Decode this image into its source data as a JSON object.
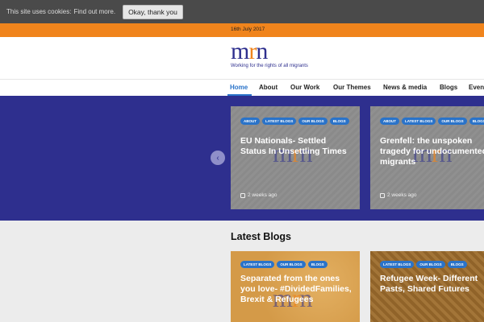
{
  "cookie_bar": {
    "text": "This site uses cookies:",
    "link": "Find out more.",
    "button": "Okay, thank you"
  },
  "date": "16th July 2017",
  "logo": {
    "mark_m": "m",
    "mark_r": "r",
    "mark_n": "n",
    "tagline": "Working for the rights of all migrants"
  },
  "nav": [
    "Home",
    "About",
    "Our Work",
    "Our Themes",
    "News & media",
    "Blogs",
    "Events"
  ],
  "hero_cards": [
    {
      "tags": [
        "About",
        "Latest Blogs",
        "Our Blogs",
        "Blogs"
      ],
      "title": "EU Nationals- Settled Status In Unsettling Times",
      "meta": "2 weeks ago"
    },
    {
      "tags": [
        "About",
        "Latest Blogs",
        "Our Blogs",
        "Blogs"
      ],
      "title": "Grenfell: the unspoken tragedy for undocumented migrants",
      "meta": "2 weeks ago"
    }
  ],
  "latest": {
    "heading": "Latest Blogs",
    "cards": [
      {
        "tags": [
          "Latest Blogs",
          "Our Blogs",
          "Blogs"
        ],
        "title": "Separated from the ones you love- #DividedFamilies, Brexit & Refugees"
      },
      {
        "tags": [
          "Latest Blogs",
          "Our Blogs",
          "Blogs"
        ],
        "title": "Refugee Week- Different Pasts, Shared Futures"
      }
    ]
  },
  "colors": {
    "brand_navy": "#2e2f8e",
    "brand_orange": "#f0841c",
    "accent_blue": "#2a73c9"
  },
  "icons": {
    "prev": "chevron-left-icon",
    "clock": "calendar-icon"
  }
}
